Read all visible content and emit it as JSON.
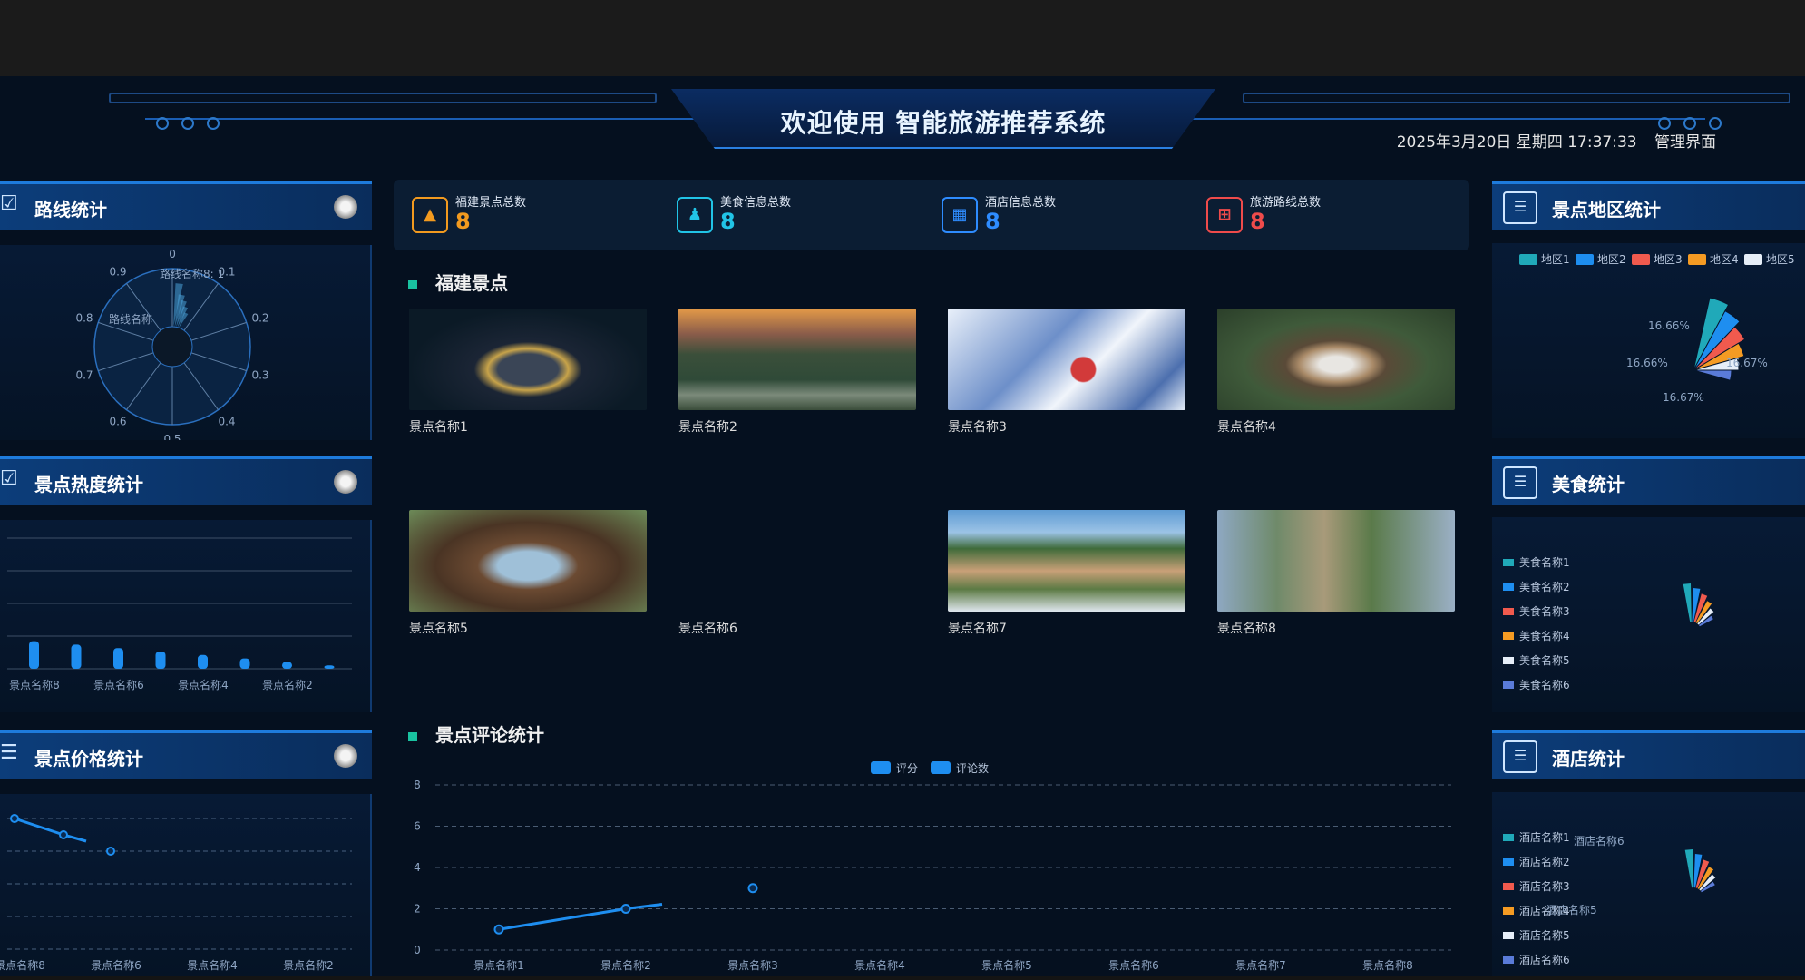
{
  "header": {
    "title": "欢迎使用 智能旅游推荐系统",
    "date": "2025年3月20日 星期四 17:37:33",
    "admin_link": "管理界面"
  },
  "left_panels": {
    "route": {
      "title": "路线统计"
    },
    "heat": {
      "title": "景点热度统计"
    },
    "price": {
      "title": "景点价格统计"
    }
  },
  "right_panels": {
    "region": {
      "title": "景点地区统计"
    },
    "food": {
      "title": "美食统计"
    },
    "hotel": {
      "title": "酒店统计"
    }
  },
  "stats": [
    {
      "label": "福建景点总数",
      "value": "8",
      "color": "#f29a1f",
      "icon": "attraction-icon"
    },
    {
      "label": "美食信息总数",
      "value": "8",
      "color": "#21c4e6",
      "icon": "food-icon"
    },
    {
      "label": "酒店信息总数",
      "value": "8",
      "color": "#2e8cff",
      "icon": "hotel-icon"
    },
    {
      "label": "旅游路线总数",
      "value": "8",
      "color": "#ef4b4b",
      "icon": "route-icon"
    }
  ],
  "attractions": {
    "title": "福建景点",
    "items": [
      {
        "name": "景点名称1"
      },
      {
        "name": "景点名称2"
      },
      {
        "name": "景点名称3"
      },
      {
        "name": "景点名称4"
      },
      {
        "name": "景点名称5"
      },
      {
        "name": "景点名称6"
      },
      {
        "name": "景点名称7"
      },
      {
        "name": "景点名称8"
      }
    ]
  },
  "review": {
    "title": "景点评论统计",
    "chart_data": {
      "type": "line",
      "categories": [
        "景点名称1",
        "景点名称2",
        "景点名称3",
        "景点名称4",
        "景点名称5",
        "景点名称6",
        "景点名称7",
        "景点名称8"
      ],
      "series": [
        {
          "name": "评分",
          "values": [
            1,
            2,
            3,
            null,
            null,
            null,
            null,
            null
          ]
        },
        {
          "name": "评论数",
          "values": [
            null,
            null,
            null,
            null,
            null,
            null,
            null,
            null
          ]
        }
      ],
      "yticks": [
        "0",
        "2",
        "4",
        "6",
        "8"
      ],
      "ylim": [
        0,
        8
      ]
    }
  },
  "route_chart": {
    "type": "polar",
    "angle_labels": [
      "0",
      "0.1",
      "0.2",
      "0.3",
      "0.4",
      "0.5",
      "0.6",
      "0.7",
      "0.8",
      "0.9"
    ],
    "labels": [
      "路线名称8: 1",
      "路线名称"
    ]
  },
  "heat_chart": {
    "type": "bar",
    "xlabels": [
      "景点名称8",
      "景点名称6",
      "景点名称4",
      "景点名称2"
    ],
    "values": [
      8,
      7,
      6,
      5,
      4,
      3,
      2,
      1
    ]
  },
  "price_chart": {
    "type": "line",
    "xlabels": [
      "景点名称8",
      "景点名称6",
      "景点名称4",
      "景点名称2"
    ]
  },
  "region_chart": {
    "type": "pie",
    "legend": [
      "地区1",
      "地区2",
      "地区3",
      "地区4",
      "地区5"
    ],
    "colors": [
      "#20a9b9",
      "#1e8ef0",
      "#f05a4e",
      "#f59b23",
      "#e6eef8"
    ],
    "labels": [
      "16.66%",
      "16.66%",
      "16.67%",
      "16.67%"
    ]
  },
  "food_chart": {
    "type": "pie",
    "legend": [
      "美食名称1",
      "美食名称2",
      "美食名称3",
      "美食名称4",
      "美食名称5",
      "美食名称6"
    ]
  },
  "hotel_chart": {
    "type": "pie",
    "legend": [
      "酒店名称1",
      "酒店名称2",
      "酒店名称3",
      "酒店名称4",
      "酒店名称5",
      "酒店名称6"
    ],
    "labels": [
      "酒店名称6",
      "酒店名称5"
    ]
  },
  "colors": {
    "legend": [
      "#20a9b9",
      "#1e8ef0",
      "#f05a4e",
      "#f59b23",
      "#e6eef8",
      "#5a7bd8"
    ]
  }
}
